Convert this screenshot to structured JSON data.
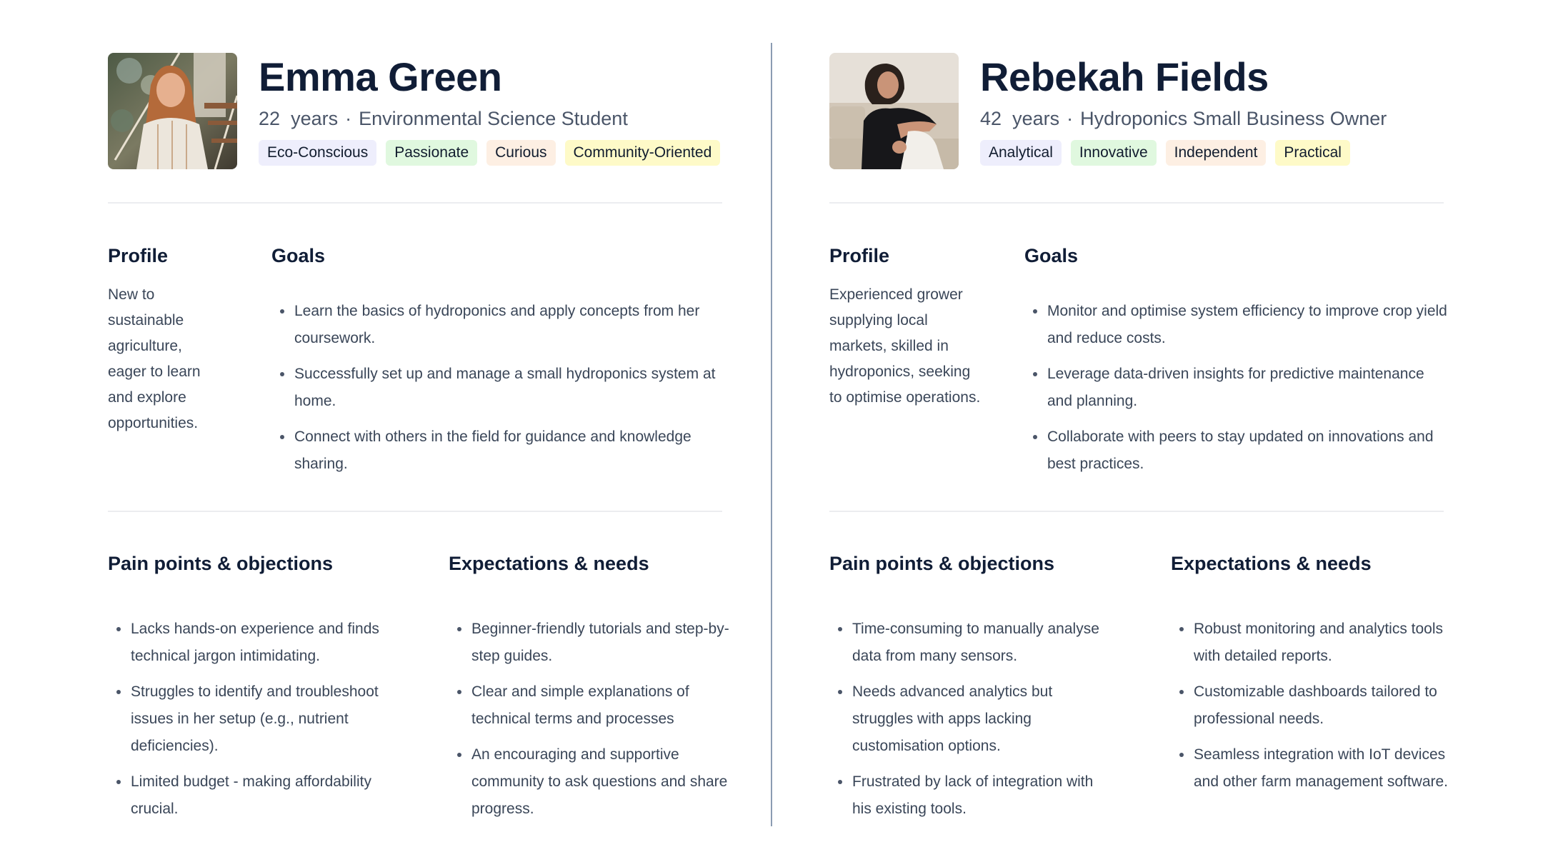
{
  "colors": {
    "tag_lavender": "#eeeefc",
    "tag_mint": "#e0f8df",
    "tag_peach": "#fdefe3",
    "tag_yellow": "#fefac8",
    "divider": "#8b9cb2",
    "heading": "#101d36",
    "body": "#3a4658"
  },
  "personas": [
    {
      "name": "Emma Green",
      "age": "22",
      "age_unit": "years",
      "separator": "·",
      "role": "Environmental Science Student",
      "photo": "photo-young-woman-smiling-on-stairs",
      "tags": [
        {
          "label": "Eco-Conscious",
          "color": "lavender"
        },
        {
          "label": "Passionate",
          "color": "mint"
        },
        {
          "label": "Curious",
          "color": "peach"
        },
        {
          "label": "Community-Oriented",
          "color": "yellow"
        }
      ],
      "profile": {
        "title": "Profile",
        "text": "New to sustainable agriculture, eager to learn and explore opportunities."
      },
      "goals": {
        "title": "Goals",
        "items": [
          "Learn the basics of hydroponics and apply concepts from her coursework.",
          "Successfully set up and manage a small hydroponics system at home.",
          "Connect with others in the field for guidance and knowledge sharing."
        ]
      },
      "pain_points": {
        "title": "Pain points & objections",
        "items": [
          "Lacks hands-on experience and finds technical jargon intimidating.",
          "Struggles to identify and troubleshoot issues in her setup (e.g., nutrient deficiencies).",
          "Limited budget - making affordability crucial."
        ]
      },
      "expectations": {
        "title": "Expectations & needs",
        "items": [
          "Beginner-friendly tutorials and step-by-step guides.",
          "Clear and simple explanations of technical terms and processes",
          "An encouraging and supportive community to ask questions and share progress."
        ]
      }
    },
    {
      "name": "Rebekah Fields",
      "age": "42",
      "age_unit": "years",
      "separator": "·",
      "role": "Hydroponics Small Business Owner",
      "photo": "photo-woman-sitting-on-sofa",
      "tags": [
        {
          "label": "Analytical",
          "color": "lavender"
        },
        {
          "label": "Innovative",
          "color": "mint"
        },
        {
          "label": "Independent",
          "color": "peach"
        },
        {
          "label": "Practical",
          "color": "yellow"
        }
      ],
      "profile": {
        "title": "Profile",
        "text": "Experienced grower supplying local markets, skilled in hydroponics, seeking to optimise operations."
      },
      "goals": {
        "title": "Goals",
        "items": [
          "Monitor and optimise system efficiency to improve crop yield and reduce costs.",
          "Leverage data-driven insights for predictive maintenance and planning.",
          "Collaborate with peers to stay updated on innovations and best practices."
        ]
      },
      "pain_points": {
        "title": "Pain points & objections",
        "items": [
          "Time-consuming to manually analyse data from many sensors.",
          "Needs advanced analytics but struggles with apps lacking customisation options.",
          "Frustrated by lack of integration with his existing tools."
        ]
      },
      "expectations": {
        "title": "Expectations & needs",
        "items": [
          "Robust monitoring and analytics tools with detailed reports.",
          "Customizable dashboards tailored to professional needs.",
          "Seamless integration with IoT devices and other farm management software."
        ]
      }
    }
  ]
}
